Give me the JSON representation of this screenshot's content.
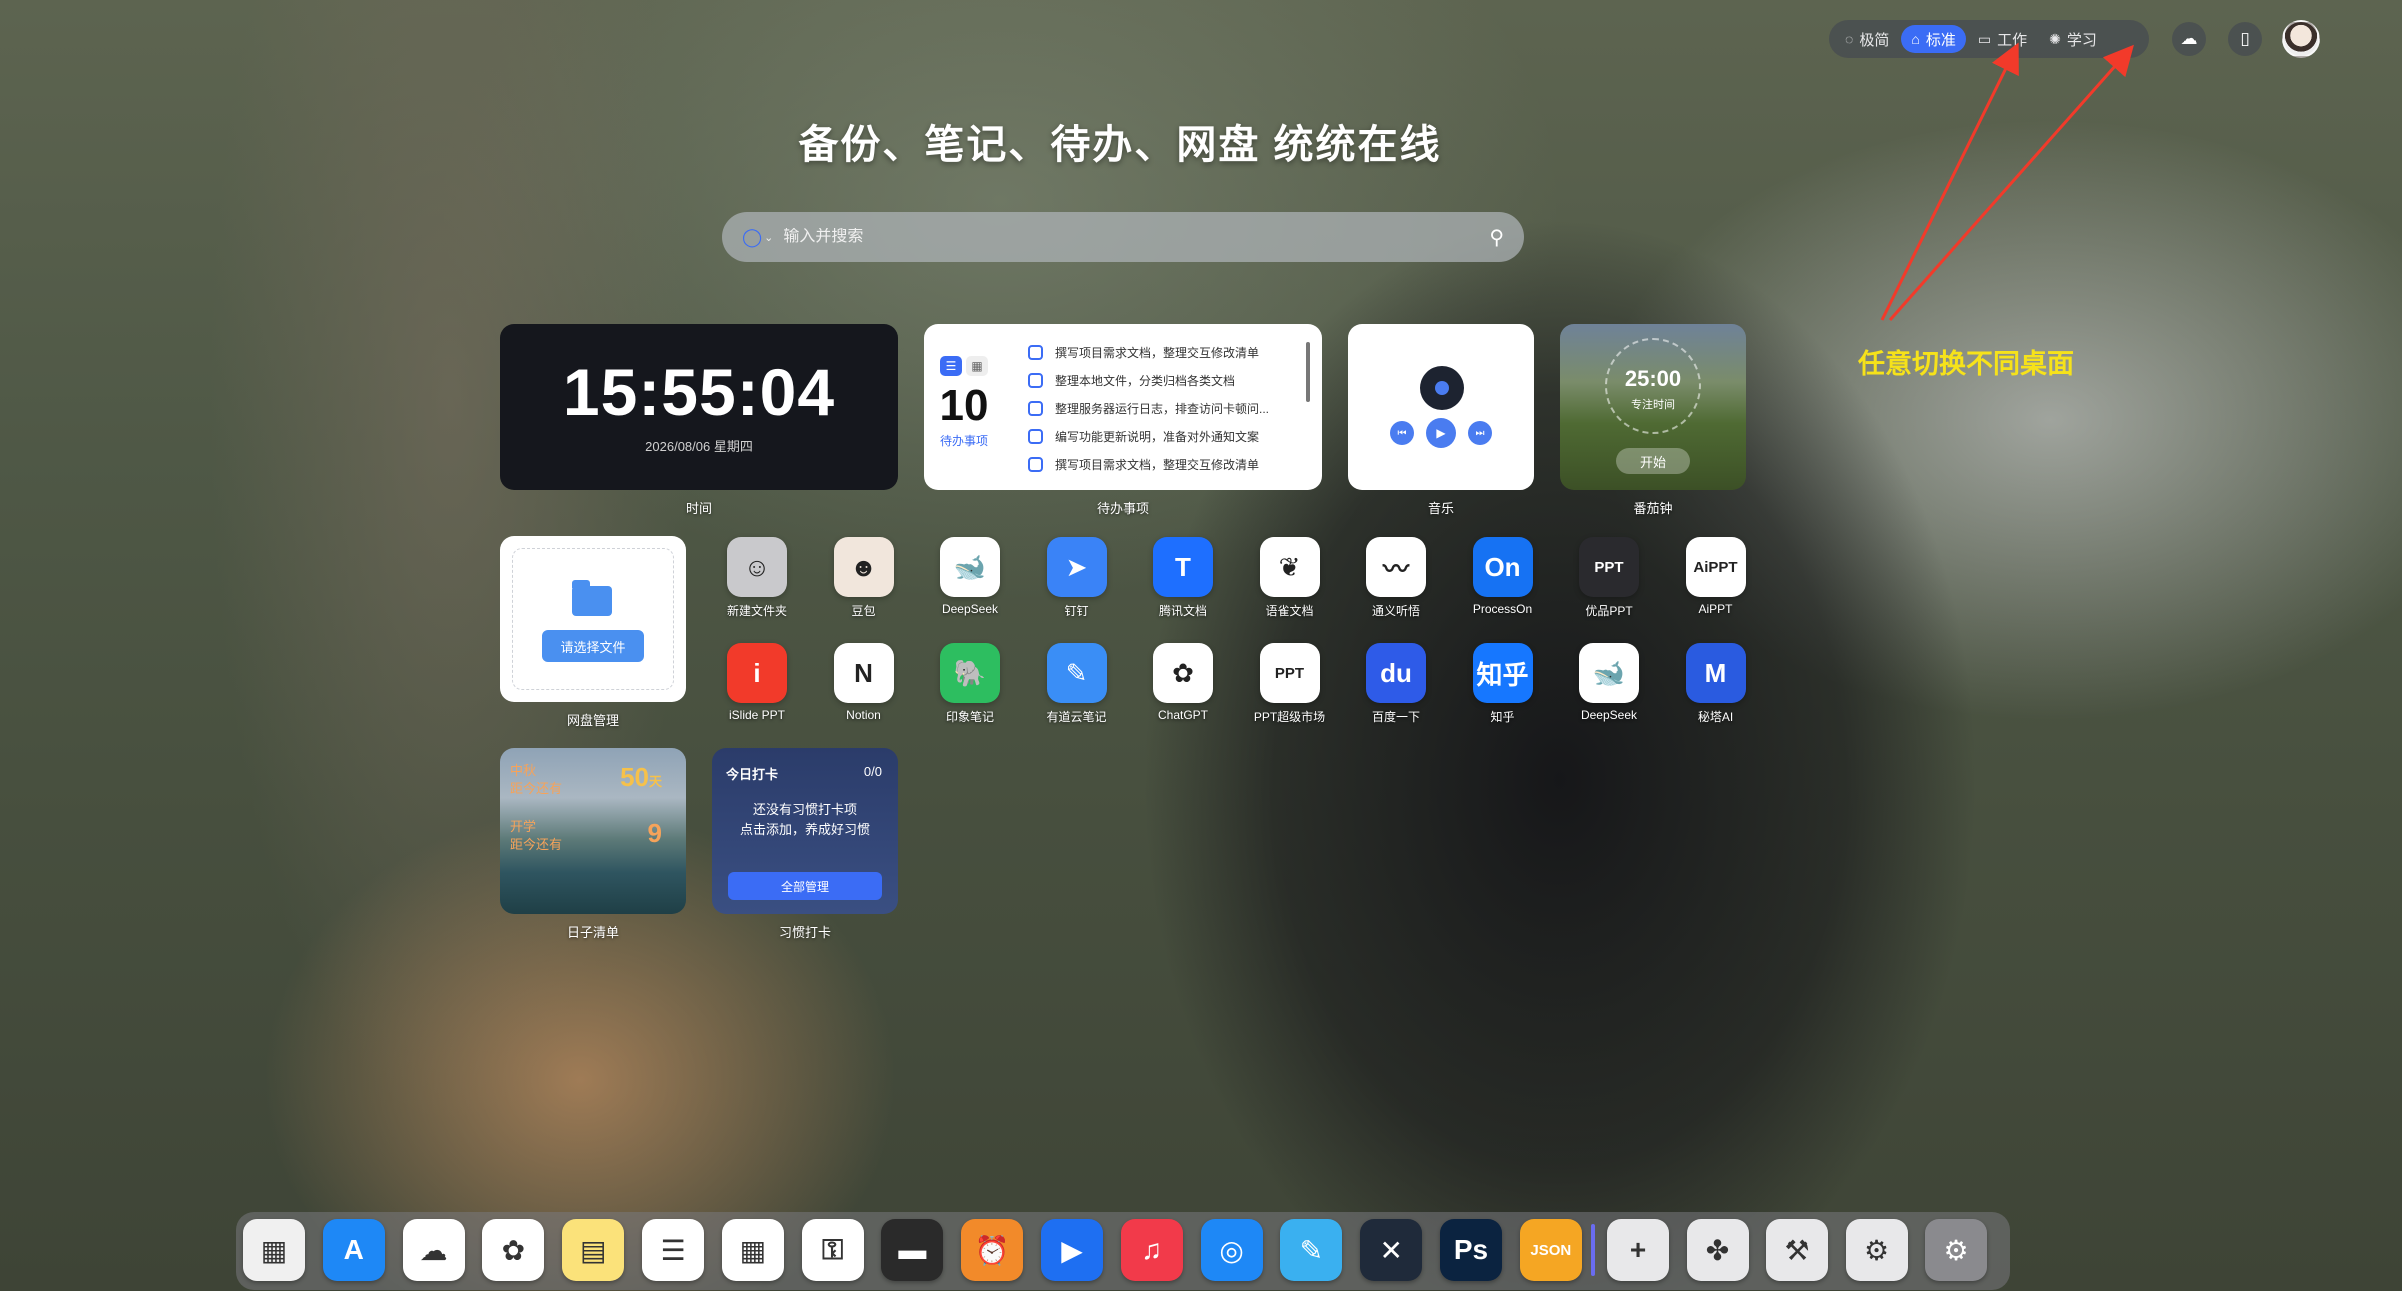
{
  "topbar": {
    "modes": [
      {
        "label": "极简",
        "icon": "eye-off-icon",
        "glyph": "◌",
        "active": false
      },
      {
        "label": "标准",
        "icon": "home-icon",
        "glyph": "⌂",
        "active": true
      },
      {
        "label": "工作",
        "icon": "briefcase-icon",
        "glyph": "▭",
        "active": false
      },
      {
        "label": "学习",
        "icon": "palette-icon",
        "glyph": "✺",
        "active": false
      }
    ],
    "cloud_glyph": "☁",
    "sidebar_glyph": "▯"
  },
  "headline": "备份、笔记、待办、网盘 统统在线",
  "search": {
    "placeholder": "输入并搜索",
    "engine_glyph": "◯",
    "chev": "⌄",
    "search_glyph": "⚲"
  },
  "clock": {
    "time": "15:55:04",
    "date": "2026/08/06 星期四",
    "label": "时间"
  },
  "todo": {
    "count": "10",
    "sub": "待办事项",
    "label": "待办事项",
    "items": [
      "撰写项目需求文档，整理交互修改清单",
      "整理本地文件，分类归档各类文档",
      "整理服务器运行日志，排查访问卡顿问...",
      "编写功能更新说明，准备对外通知文案",
      "撰写项目需求文档，整理交互修改清单"
    ]
  },
  "music": {
    "label": "音乐",
    "prev": "⏮",
    "play": "▶",
    "next": "⏭"
  },
  "pomodoro": {
    "time": "25:00",
    "sub": "专注时间",
    "start": "开始",
    "label": "番茄钟"
  },
  "disk": {
    "button": "请选择文件",
    "label": "网盘管理"
  },
  "apps": [
    {
      "label": "新建文件夹",
      "icon": "folder-icon",
      "glyph": "☺",
      "color": "#c9c9cc"
    },
    {
      "label": "豆包",
      "icon": "doubao-icon",
      "glyph": "☻",
      "color": "#f1e6dc"
    },
    {
      "label": "DeepSeek",
      "icon": "deepseek-icon",
      "glyph": "🐋",
      "color": "#ffffff"
    },
    {
      "label": "钉钉",
      "icon": "dingtalk-icon",
      "glyph": "➤",
      "color": "#3a83f7"
    },
    {
      "label": "腾讯文档",
      "icon": "tencent-docs-icon",
      "glyph": "T",
      "color": "#1e6fff"
    },
    {
      "label": "语雀文档",
      "icon": "yuque-icon",
      "glyph": "❦",
      "color": "#ffffff"
    },
    {
      "label": "通义听悟",
      "icon": "tongyi-icon",
      "glyph": "〰",
      "color": "#ffffff"
    },
    {
      "label": "ProcessOn",
      "icon": "processon-icon",
      "glyph": "On",
      "color": "#1672f3"
    },
    {
      "label": "优品PPT",
      "icon": "youpin-ppt-icon",
      "glyph": "PPT",
      "color": "#2a2a2e"
    },
    {
      "label": "AiPPT",
      "icon": "aippt-icon",
      "glyph": "AiPPT",
      "color": "#ffffff"
    },
    {
      "label": "iSlide PPT",
      "icon": "islide-icon",
      "glyph": "i",
      "color": "#f23a2a"
    },
    {
      "label": "Notion",
      "icon": "notion-icon",
      "glyph": "N",
      "color": "#ffffff"
    },
    {
      "label": "印象笔记",
      "icon": "evernote-icon",
      "glyph": "🐘",
      "color": "#2dbe60"
    },
    {
      "label": "有道云笔记",
      "icon": "youdao-note-icon",
      "glyph": "✎",
      "color": "#3a8ef6"
    },
    {
      "label": "ChatGPT",
      "icon": "chatgpt-icon",
      "glyph": "✿",
      "color": "#ffffff"
    },
    {
      "label": "PPT超级市场",
      "icon": "ppt-market-icon",
      "glyph": "PPT",
      "color": "#ffffff"
    },
    {
      "label": "百度一下",
      "icon": "baidu-icon",
      "glyph": "du",
      "color": "#2e5be8"
    },
    {
      "label": "知乎",
      "icon": "zhihu-icon",
      "glyph": "知乎",
      "color": "#1677ff"
    },
    {
      "label": "DeepSeek",
      "icon": "deepseek-icon",
      "glyph": "🐋",
      "color": "#ffffff"
    },
    {
      "label": "秘塔AI",
      "icon": "metaso-icon",
      "glyph": "M",
      "color": "#2a5be0"
    }
  ],
  "diary": {
    "top_text": "中秋\n距今还有",
    "top_num": "50",
    "top_unit": "天",
    "bottom_text": "开学\n距今还有",
    "bottom_num": "9",
    "label": "日子清单"
  },
  "habit": {
    "title": "今日打卡",
    "count": "0/0",
    "message": "还没有习惯打卡项\n点击添加，养成好习惯",
    "button": "全部管理",
    "label": "习惯打卡"
  },
  "annotation": "任意切换不同桌面",
  "dock": [
    {
      "name": "launchpad-icon",
      "glyph": "▦",
      "color": "#f0f0f0"
    },
    {
      "name": "app-store-icon",
      "glyph": "A",
      "color": "#1e88f6"
    },
    {
      "name": "icloud-icon",
      "glyph": "☁",
      "color": "#ffffff"
    },
    {
      "name": "photos-icon",
      "glyph": "✿",
      "color": "#ffffff"
    },
    {
      "name": "notes-icon",
      "glyph": "▤",
      "color": "#fbe27a"
    },
    {
      "name": "reminders-icon",
      "glyph": "☰",
      "color": "#ffffff"
    },
    {
      "name": "calendar-icon",
      "glyph": "▦",
      "color": "#ffffff"
    },
    {
      "name": "keychain-icon",
      "glyph": "⚿",
      "color": "#ffffff"
    },
    {
      "name": "wallet-icon",
      "glyph": "▬",
      "color": "#2a2a2a"
    },
    {
      "name": "alarm-icon",
      "glyph": "⏰",
      "color": "#f28a2a"
    },
    {
      "name": "player-icon",
      "glyph": "▶",
      "color": "#1e6ff2"
    },
    {
      "name": "music-icon",
      "glyph": "♫",
      "color": "#f23a4a"
    },
    {
      "name": "safari-icon",
      "glyph": "◎",
      "color": "#1e88f6"
    },
    {
      "name": "pen-icon",
      "glyph": "✎",
      "color": "#3ab0f0"
    },
    {
      "name": "xmind-icon",
      "glyph": "✕",
      "color": "#1f2a3a"
    },
    {
      "name": "photoshop-icon",
      "glyph": "Ps",
      "color": "#0b2340"
    },
    {
      "name": "json-icon",
      "glyph": "JSON",
      "color": "#f5a623"
    },
    {
      "name": "add-icon",
      "glyph": "+",
      "color": "#e8e8ea"
    },
    {
      "name": "plugin-icon",
      "glyph": "✤",
      "color": "#e8e8ea"
    },
    {
      "name": "brush-icon",
      "glyph": "⚒",
      "color": "#e8e8ea"
    },
    {
      "name": "settings-gear-icon",
      "glyph": "⚙",
      "color": "#e8e8ea"
    },
    {
      "name": "system-settings-icon",
      "glyph": "⚙",
      "color": "#8a8a8e"
    }
  ]
}
